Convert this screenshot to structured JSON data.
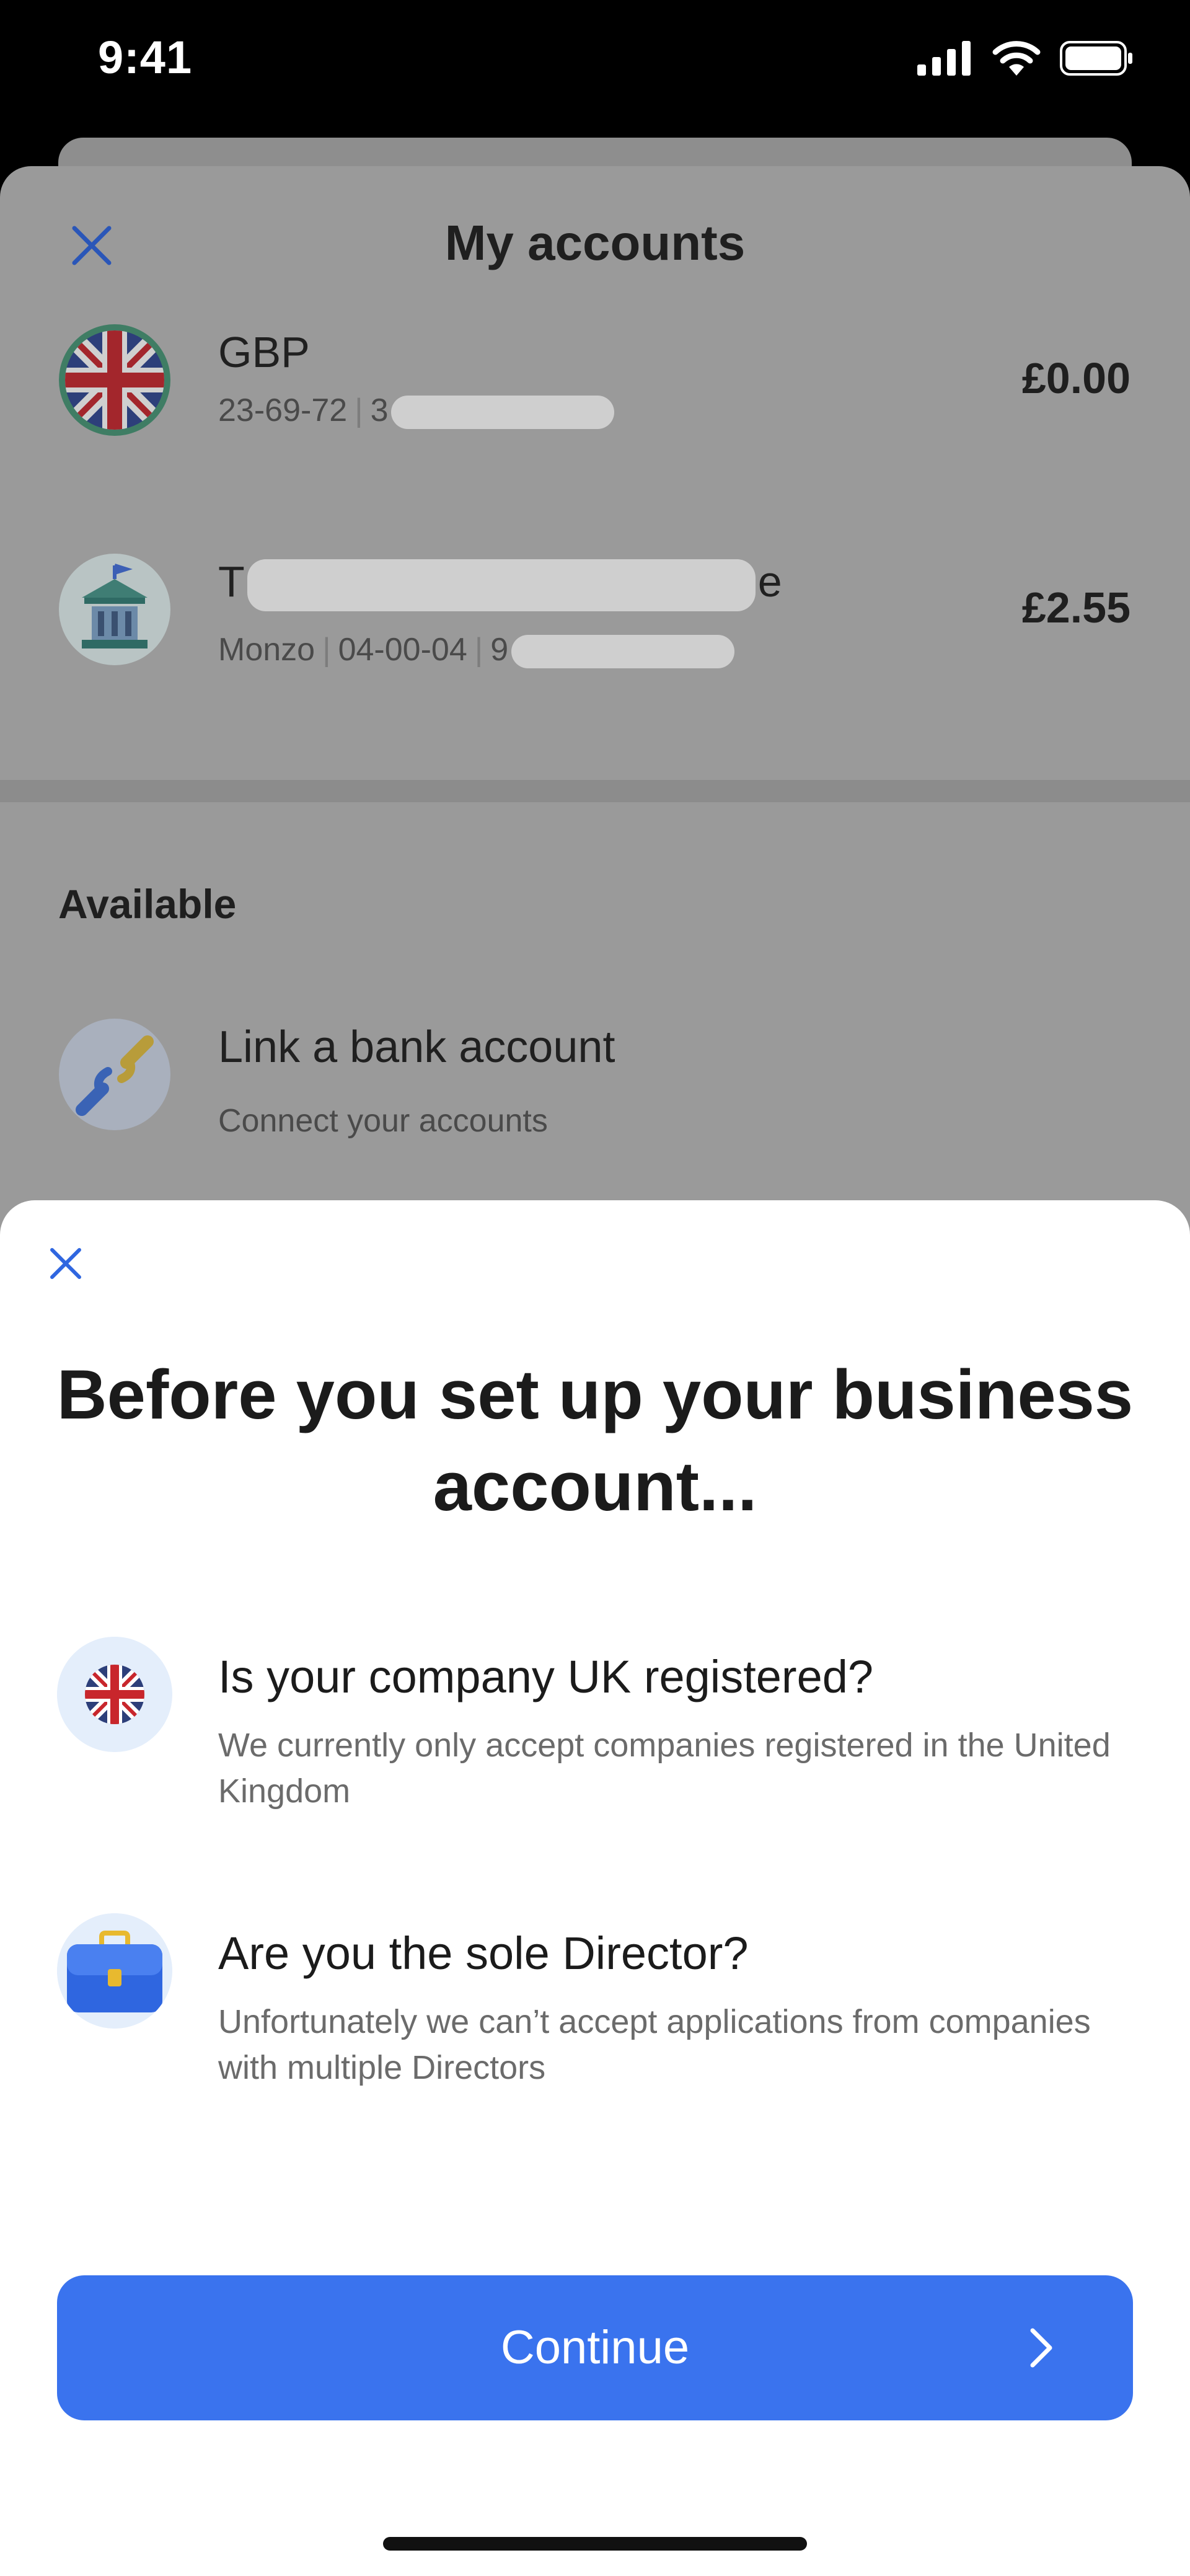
{
  "status_bar": {
    "time": "9:41"
  },
  "background": {
    "title": "My accounts",
    "accounts": [
      {
        "name": "GBP",
        "sort_code": "23-69-72",
        "number_prefix": "3",
        "balance": "£0.00"
      },
      {
        "name_prefix": "T",
        "name_suffix": "e",
        "bank": "Monzo",
        "sort_code": "04-00-04",
        "number_prefix": "9",
        "balance": "£2.55"
      }
    ],
    "available_title": "Available",
    "link": {
      "title": "Link a bank account",
      "subtitle": "Connect your accounts"
    }
  },
  "sheet": {
    "title": "Before you set up your business account...",
    "requirements": [
      {
        "title": "Is your company UK registered?",
        "description": "We currently only accept companies registered in the United Kingdom"
      },
      {
        "title": "Are you the sole Director?",
        "description": "Unfortunately we can’t accept applications from companies with multiple Directors"
      }
    ],
    "continue_label": "Continue"
  },
  "colors": {
    "accent": "#3a73ee",
    "dim_overlay": "#9a9a9a"
  },
  "icons": [
    "close-icon",
    "uk-flag-icon",
    "bank-icon",
    "chain-link-icon",
    "plus-icon",
    "briefcase-icon",
    "chevron-right-icon"
  ]
}
